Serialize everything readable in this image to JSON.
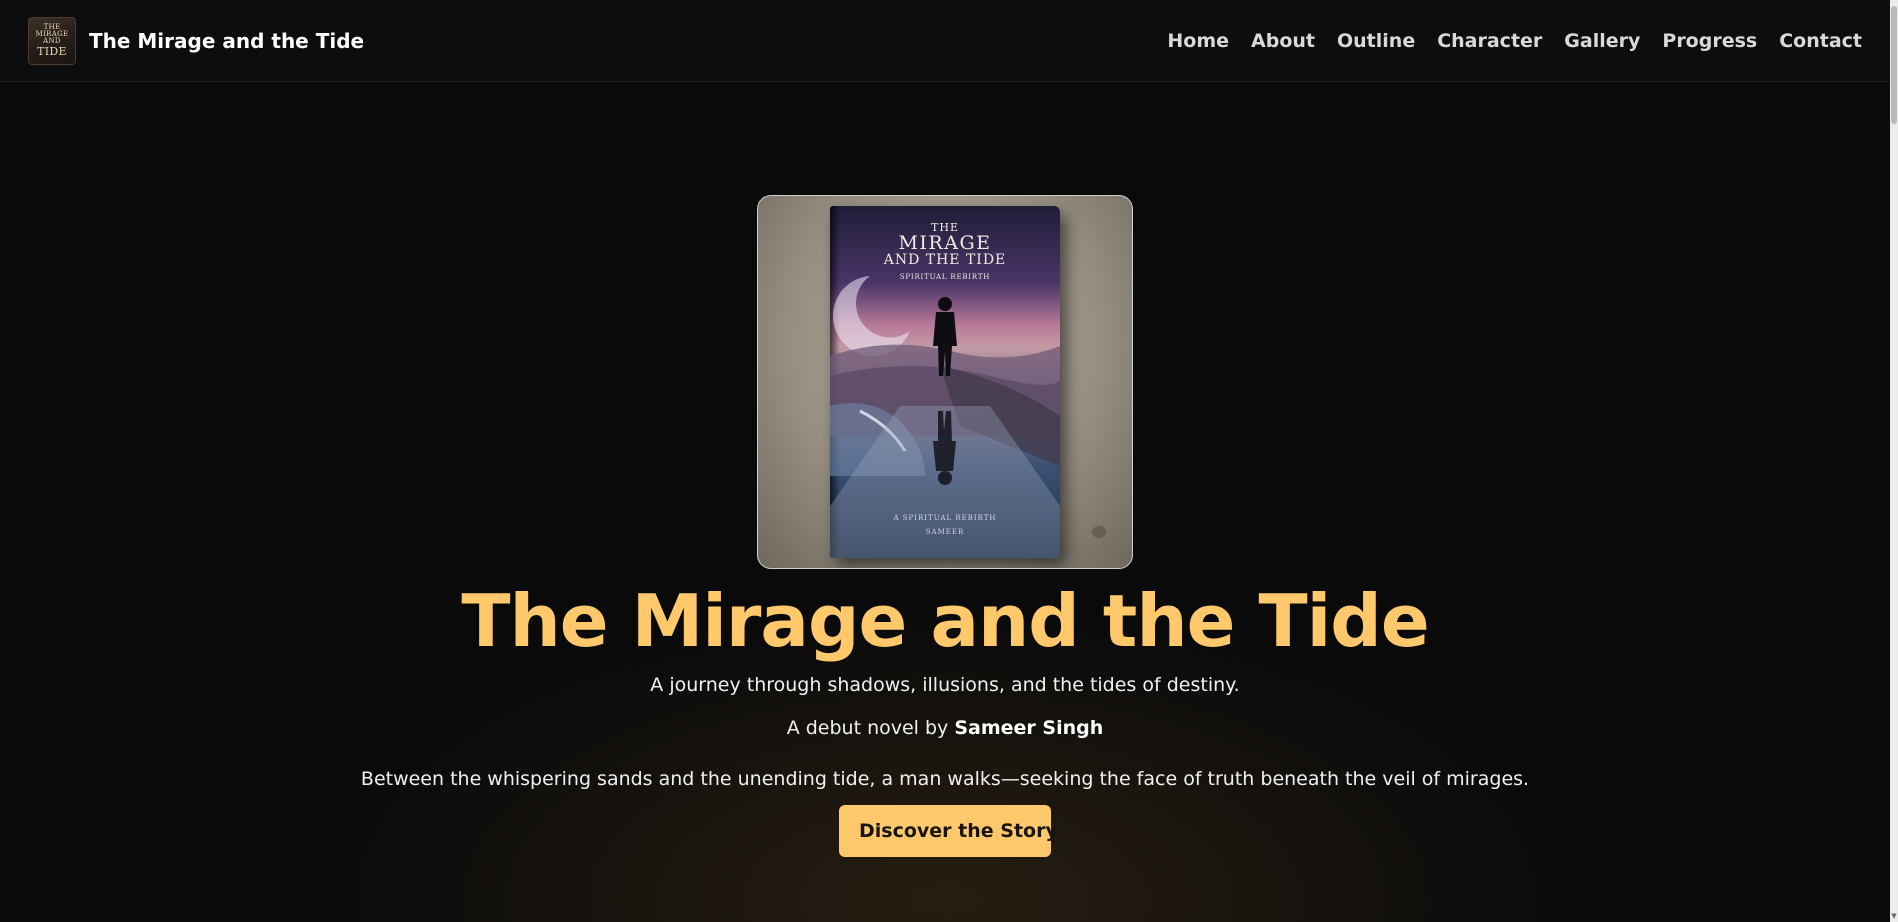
{
  "nav": {
    "logo_lines": [
      "THE",
      "MIRAGE",
      "AND",
      "TIDE"
    ],
    "brand": "The Mirage and the Tide",
    "links": [
      "Home",
      "About",
      "Outline",
      "Character",
      "Gallery",
      "Progress",
      "Contact"
    ]
  },
  "cover": {
    "line1": "THE",
    "line2": "MIRAGE",
    "line3": "AND THE TIDE",
    "line4": "SPIRITUAL REBIRTH",
    "footer1": "A SPIRITUAL REBIRTH",
    "footer2": "SAMEER"
  },
  "hero": {
    "title": "The Mirage and the Tide",
    "tagline": "A journey through shadows, illusions, and the tides of destiny.",
    "byline_prefix": "A debut novel by ",
    "author": "Sameer Singh",
    "lede": "Between the whispering sands and the unending tide, a man walks—seeking the face of truth beneath the veil of mirages.",
    "cta": "Discover the Story"
  },
  "colors": {
    "accent": "#ffc96b",
    "background": "#0a0a0b",
    "nav_background": "#0d0d0f"
  }
}
